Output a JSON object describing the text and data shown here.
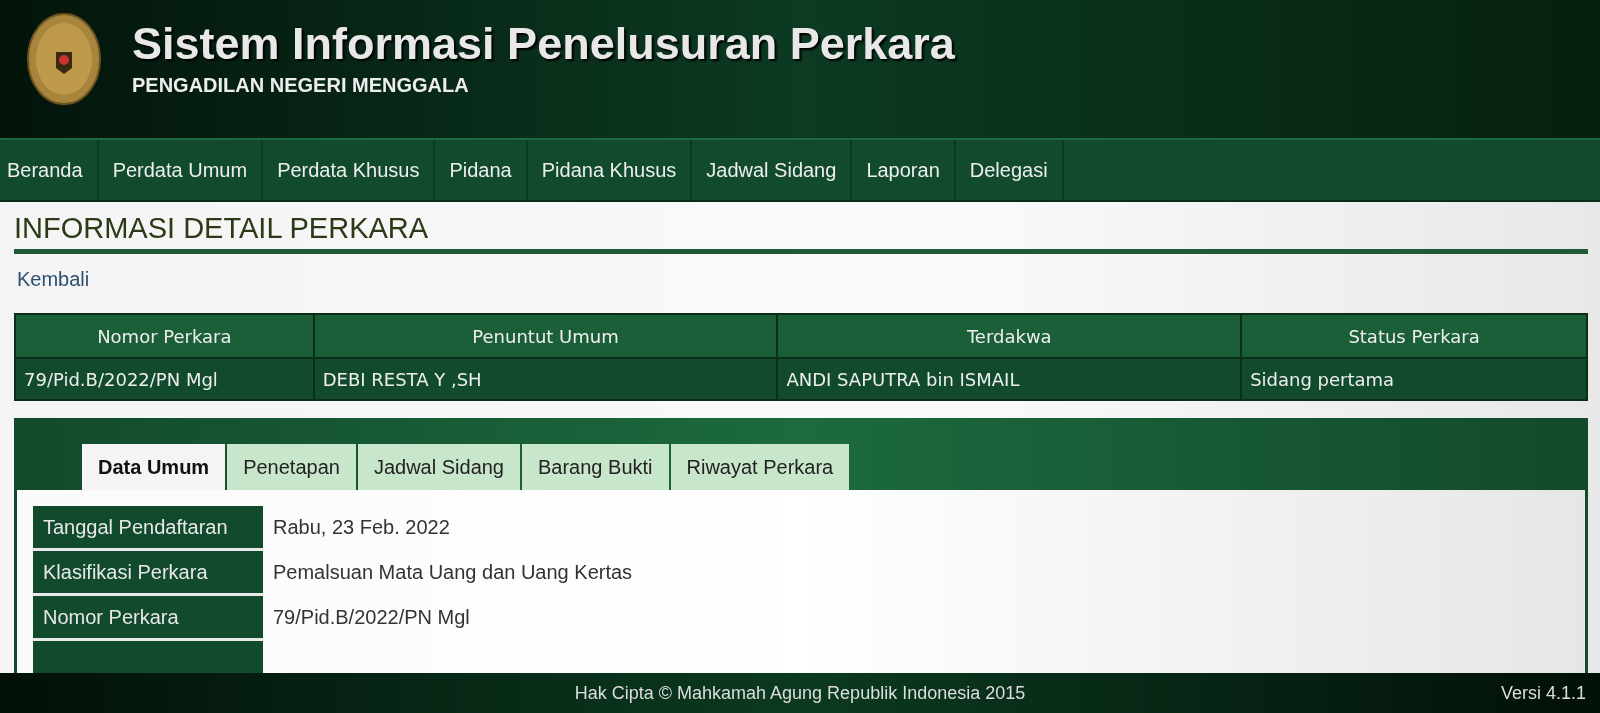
{
  "header": {
    "title": "Sistem Informasi Penelusuran Perkara",
    "subtitle": "PENGADILAN NEGERI MENGGALA"
  },
  "nav": [
    "Beranda",
    "Perdata Umum",
    "Perdata Khusus",
    "Pidana",
    "Pidana Khusus",
    "Jadwal Sidang",
    "Laporan",
    "Delegasi"
  ],
  "page_title": "INFORMASI DETAIL PERKARA",
  "back_link": "Kembali",
  "case_table": {
    "columns": [
      "Nomor Perkara",
      "Penuntut Umum",
      "Terdakwa",
      "Status Perkara"
    ],
    "rows": [
      [
        "79/Pid.B/2022/PN Mgl",
        "DEBI RESTA Y ,SH",
        "ANDI SAPUTRA bin ISMAIL",
        "Sidang pertama"
      ]
    ]
  },
  "tabs": [
    {
      "label": "Data Umum",
      "selected": true
    },
    {
      "label": "Penetapan",
      "selected": false
    },
    {
      "label": "Jadwal Sidang",
      "selected": false
    },
    {
      "label": "Barang Bukti",
      "selected": false
    },
    {
      "label": "Riwayat Perkara",
      "selected": false
    }
  ],
  "details": [
    {
      "label": "Tanggal Pendaftaran",
      "value": "Rabu, 23 Feb. 2022"
    },
    {
      "label": "Klasifikasi Perkara",
      "value": "Pemalsuan Mata Uang dan Uang Kertas"
    },
    {
      "label": "Nomor Perkara",
      "value": "79/Pid.B/2022/PN Mgl"
    }
  ],
  "footer": {
    "copyright": "Hak Cipta © Mahkamah Agung Republik Indonesia 2015",
    "version": "Versi 4.1.1"
  }
}
